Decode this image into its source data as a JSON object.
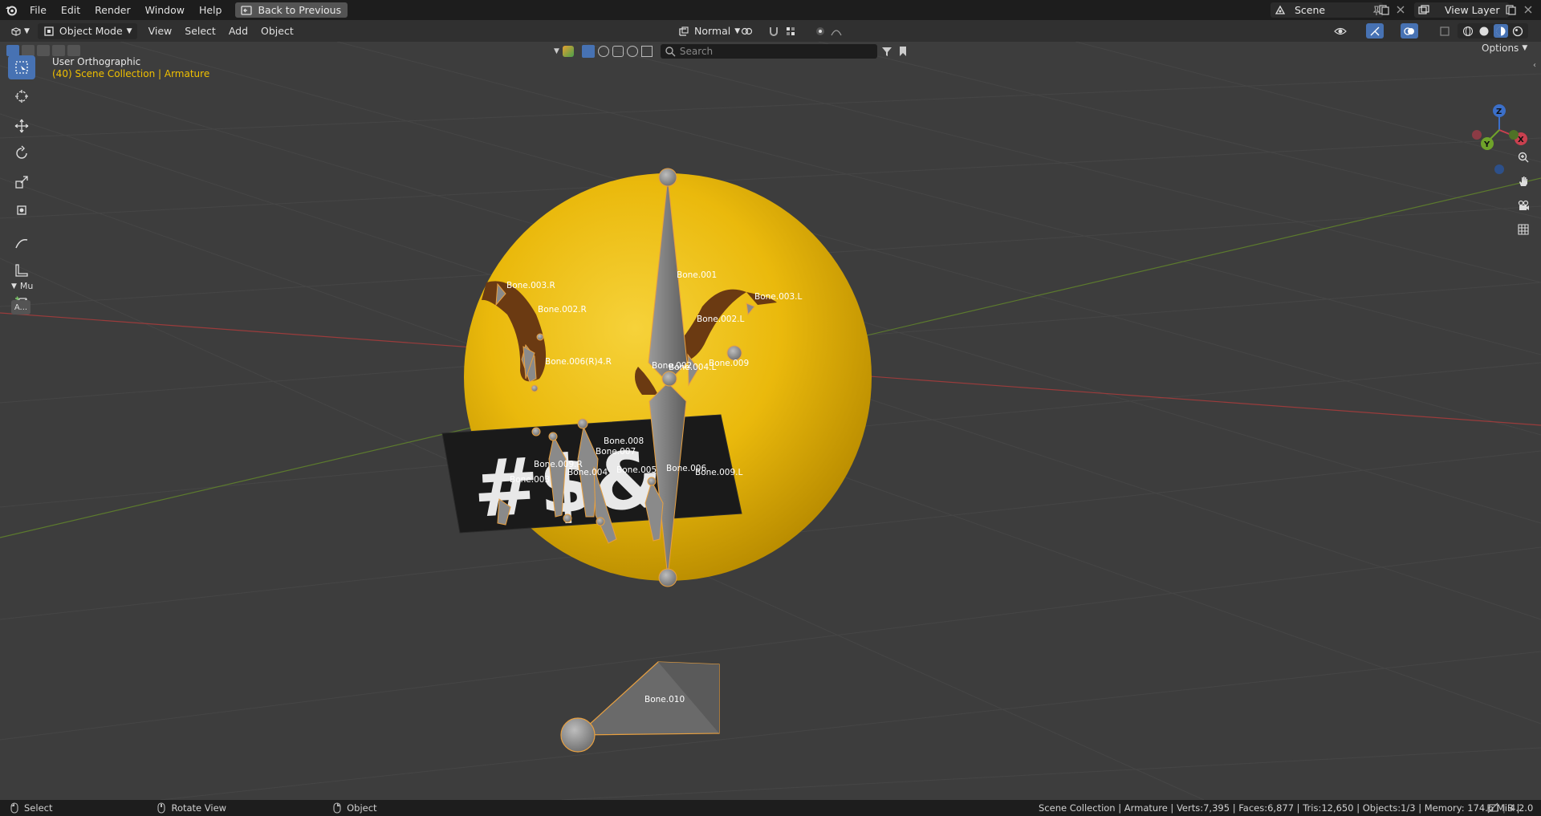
{
  "menu": {
    "file": "File",
    "edit": "Edit",
    "render": "Render",
    "window": "Window",
    "help": "Help",
    "back_to_previous": "Back to Previous"
  },
  "scene_selector": {
    "value": "Scene"
  },
  "view_layer_selector": {
    "value": "View Layer"
  },
  "header": {
    "mode": "Object Mode",
    "view": "View",
    "select": "Select",
    "add": "Add",
    "object": "Object",
    "transform_orientation": "Normal",
    "options": "Options"
  },
  "outliner_search": {
    "placeholder": "Search"
  },
  "viewport": {
    "view_name": "User Orthographic",
    "collection_info": "(40) Scene Collection | Armature",
    "panel_toggle_label": "Mu",
    "panel_button_label": "A..."
  },
  "bones": [
    {
      "name": "Bone.001"
    },
    {
      "name": "Bone.003.R"
    },
    {
      "name": "Bone.002.R"
    },
    {
      "name": "Bone.003.L"
    },
    {
      "name": "Bone.002.L"
    },
    {
      "name": "Bone.006(R)4.R"
    },
    {
      "name": "Bone.002"
    },
    {
      "name": "Bone.004.L"
    },
    {
      "name": "Bone.009"
    },
    {
      "name": "Bone.008"
    },
    {
      "name": "Bone.007"
    },
    {
      "name": "Bone.009.R"
    },
    {
      "name": "Bone.003"
    },
    {
      "name": "Bone.004"
    },
    {
      "name": "Bone.005"
    },
    {
      "name": "Bone.006"
    },
    {
      "name": "Bone.009.L"
    },
    {
      "name": "Bone.010"
    }
  ],
  "sign_text": "#$&",
  "gizmo": {
    "z": "Z",
    "x": "X",
    "y": "Y"
  },
  "status_bar": {
    "select": "Select",
    "rotate_view": "Rotate View",
    "object": "Object",
    "stats": "Scene Collection | Armature | Verts:7,395 | Faces:6,877 | Tris:12,650 | Objects:1/3 | Memory: 174.6 MiB |",
    "version": "4.2.0"
  },
  "colors": {
    "accent": "#4772b3",
    "selection_orange": "#e8a040",
    "active_text": "#f0c000",
    "emoji_yellow": "#f2c10e",
    "brow_brown": "#6b3a12"
  }
}
